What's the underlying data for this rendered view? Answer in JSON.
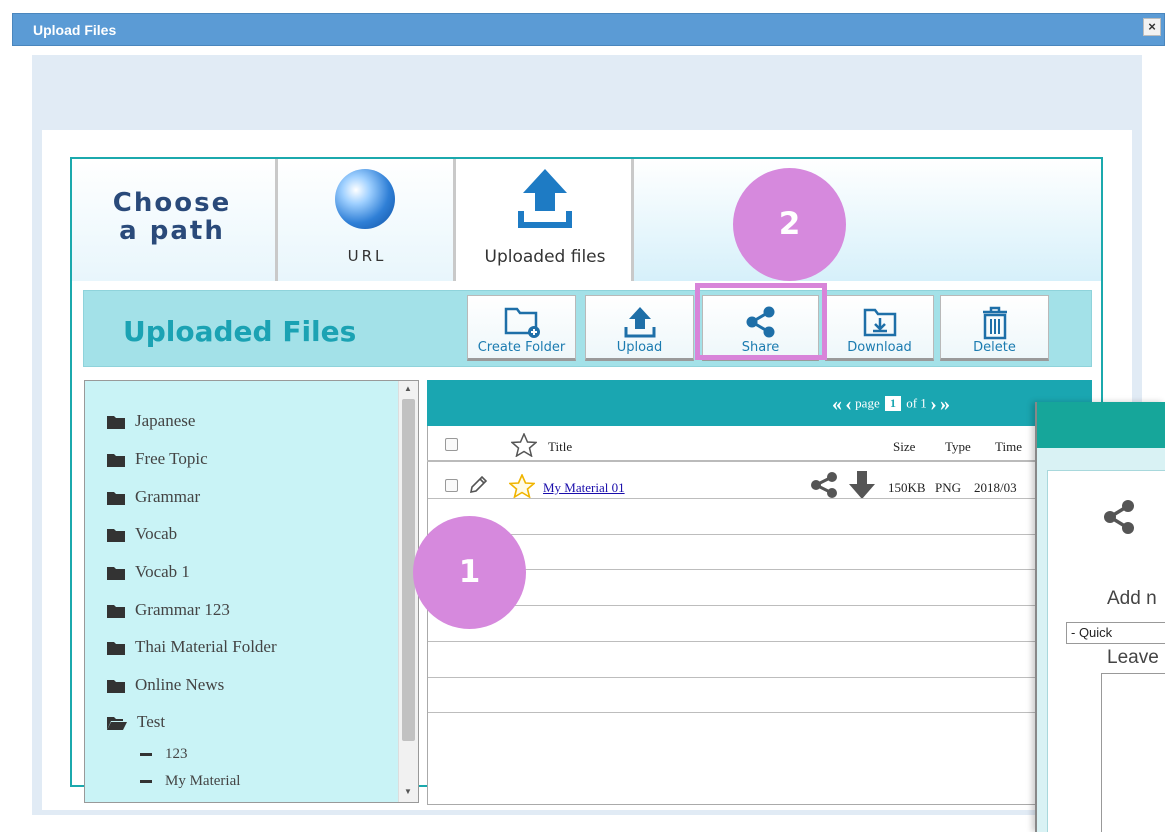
{
  "dialog": {
    "title": "Upload Files",
    "close_label": "×"
  },
  "tabs": {
    "choose_line1": "Choose",
    "choose_line2": "a path",
    "url": "URL",
    "uploaded": "Uploaded files"
  },
  "toolbar": {
    "title": "Uploaded Files",
    "create_folder": "Create Folder",
    "upload": "Upload",
    "share": "Share",
    "download": "Download",
    "delete": "Delete"
  },
  "folders": [
    {
      "name": "Japanese",
      "icon": "folder-icon"
    },
    {
      "name": "Free Topic",
      "icon": "folder-icon"
    },
    {
      "name": "Grammar",
      "icon": "folder-icon"
    },
    {
      "name": "Vocab",
      "icon": "folder-icon"
    },
    {
      "name": "Vocab 1",
      "icon": "folder-icon"
    },
    {
      "name": "Grammar 123",
      "icon": "folder-icon"
    },
    {
      "name": "Thai Material Folder",
      "icon": "folder-icon"
    },
    {
      "name": "Online News",
      "icon": "folder-icon"
    },
    {
      "name": "Test",
      "icon": "folder-open-icon"
    }
  ],
  "subfolders": [
    "123",
    "My Material"
  ],
  "pager": {
    "prefix": "page",
    "current": "1",
    "suffix": "of 1"
  },
  "columns": {
    "title": "Title",
    "size": "Size",
    "type": "Type",
    "time": "Time"
  },
  "files": [
    {
      "title": "My Material 01",
      "size": "150KB",
      "type": "PNG",
      "time": "2018/03"
    }
  ],
  "share_panel": {
    "add_label": "Add n",
    "quick_select": "- Quick",
    "leave_label": "Leave"
  },
  "badges": {
    "one": "1",
    "two": "2"
  },
  "colors": {
    "accent": "#1aa6b1",
    "titlebar": "#5b9bd5",
    "highlight": "#d884d9"
  }
}
